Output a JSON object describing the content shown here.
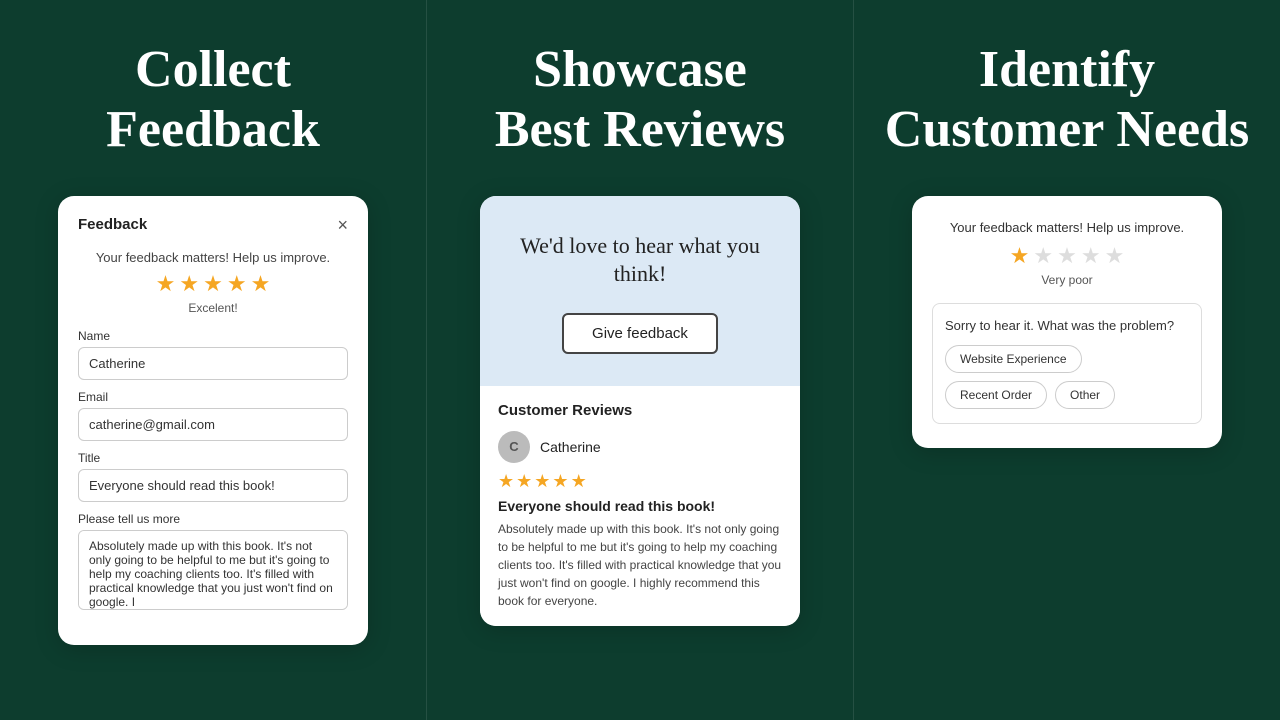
{
  "panel1": {
    "title": "Collect\nFeedback",
    "card": {
      "header": "Feedback",
      "close_label": "×",
      "tagline": "Your feedback matters! Help us improve.",
      "stars": [
        true,
        true,
        true,
        true,
        true
      ],
      "rating_label": "Excelent!",
      "name_label": "Name",
      "name_value": "Catherine",
      "email_label": "Email",
      "email_value": "catherine@gmail.com",
      "title_label": "Title",
      "title_value": "Everyone should read this book!",
      "more_label": "Please tell us more",
      "more_value": "Absolutely made up with this book. It's not only going to be helpful to me but it's going to help my coaching clients too. It's filled with practical knowledge that you just won't find on google. I"
    }
  },
  "panel2": {
    "title": "Showcase\nBest Reviews",
    "card": {
      "headline": "We'd love to hear what you think!",
      "button_label": "Give feedback",
      "reviews_title": "Customer Reviews",
      "reviewer_initial": "C",
      "reviewer_name": "Catherine",
      "review_stars": [
        true,
        true,
        true,
        true,
        true
      ],
      "review_title": "Everyone should read this book!",
      "review_text": "Absolutely made up with this book. It's not only going to be helpful to me but it's going to help my coaching clients too. It's filled with practical knowledge that you just won't find on google. I highly recommend this book for everyone."
    }
  },
  "panel3": {
    "title": "Identify\nCustomer Needs",
    "card": {
      "tagline": "Your feedback matters! Help us improve.",
      "stars_filled": 1,
      "stars_total": 5,
      "rating_label": "Very poor",
      "problem_question": "Sorry to hear it. What was the problem?",
      "tags": [
        "Website Experience",
        "Recent Order",
        "Other"
      ]
    }
  }
}
